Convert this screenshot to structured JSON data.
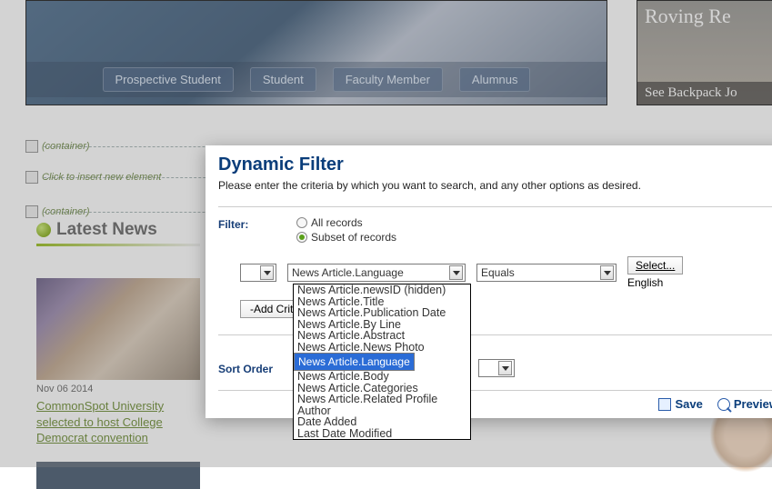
{
  "hero": {
    "buttons": [
      "Prospective Student",
      "Student",
      "Faculty Member",
      "Alumnus"
    ]
  },
  "side_hero": {
    "title": "Roving Re",
    "cta": "See Backpack Jo"
  },
  "cs": {
    "container_label": "(container)",
    "insert_label": "Click to insert new element"
  },
  "news": {
    "heading": "Latest News",
    "items": [
      {
        "date": "Nov 06 2014",
        "title": "CommonSpot University selected to host College Democrat convention"
      }
    ]
  },
  "dialog": {
    "title": "Dynamic Filter",
    "subtitle": "Please enter the criteria by which you want to search, and any other options as desired.",
    "filter_label": "Filter:",
    "radio_all": "All records",
    "radio_subset": "Subset of records",
    "field_value": "News Article.Language",
    "operator_value": "Equals",
    "select_btn": "Select...",
    "select_value": "English",
    "add_criteria_btn": "-Add Crite",
    "sort_label": "Sort Order",
    "save": "Save",
    "preview": "Preview"
  },
  "dropdown": {
    "options": [
      "News Article.newsID (hidden)",
      "News Article.Title",
      "News Article.Publication Date",
      "News Article.By Line",
      "News Article.Abstract",
      "News Article.News Photo",
      "News Article.Language",
      "News Article.Body",
      "News Article.Categories",
      "News Article.Related Profile",
      "Author",
      "Date Added",
      "Last Date Modified"
    ],
    "selected_index": 6
  }
}
